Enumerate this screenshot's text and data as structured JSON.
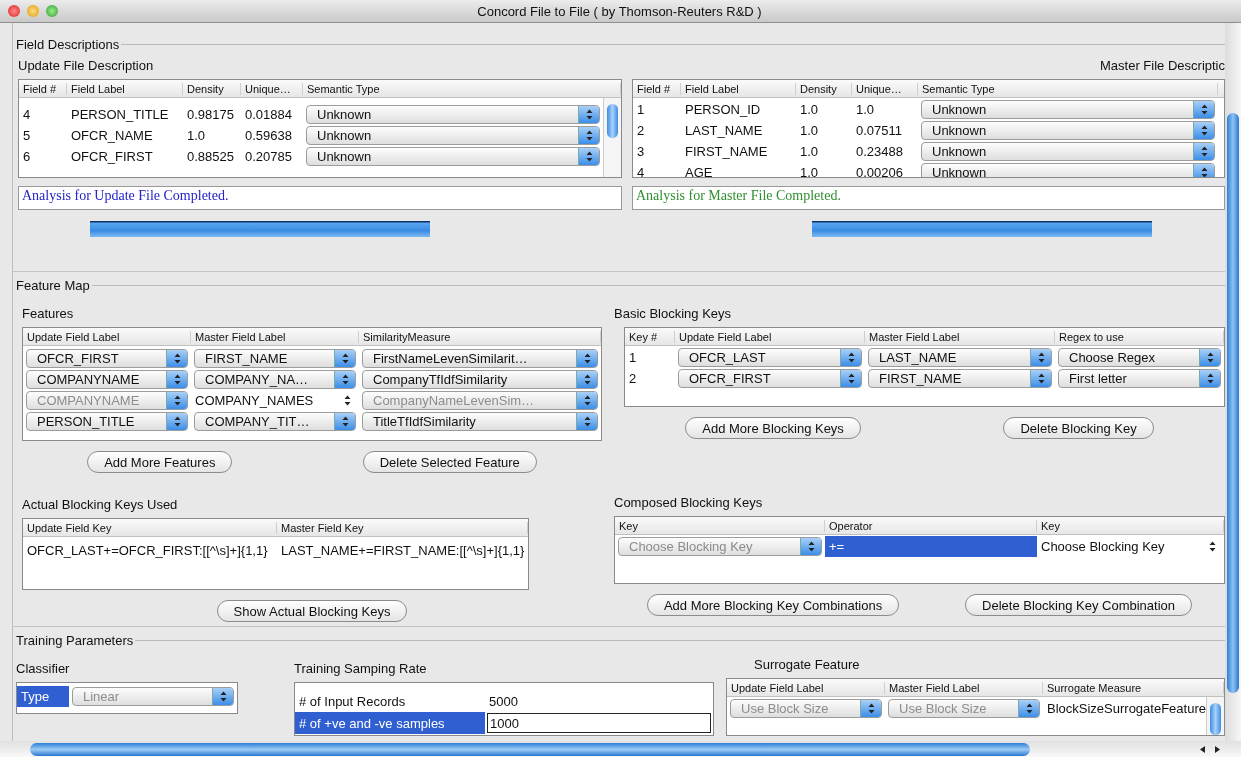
{
  "window": {
    "title": "Concord File to File ( by Thomson-Reuters R&D )"
  },
  "field_descriptions": {
    "title": "Field Descriptions",
    "update": {
      "title": "Update File Description",
      "columns": [
        "Field #",
        "Field Label",
        "Density",
        "Unique…",
        "Semantic Type"
      ],
      "rows": [
        [
          "4",
          "PERSON_TITLE",
          "0.98175",
          "0.01884",
          {
            "kind": "combo",
            "value": "Unknown",
            "disabled": false
          }
        ],
        [
          "5",
          "OFCR_NAME",
          "1.0",
          "0.59638",
          {
            "kind": "combo",
            "value": "Unknown",
            "disabled": false
          }
        ],
        [
          "6",
          "OFCR_FIRST",
          "0.88525",
          "0.20785",
          {
            "kind": "combo",
            "value": "Unknown",
            "disabled": false
          }
        ]
      ],
      "status": "Analysis for Update File Completed.",
      "color": "#2323c8",
      "progress": {
        "level": 1
      }
    },
    "master": {
      "title": "Master File Descriptic",
      "columns": [
        "Field #",
        "Field Label",
        "Density",
        "Unique…",
        "Semantic Type"
      ],
      "rows": [
        [
          "1",
          "PERSON_ID",
          "1.0",
          "1.0",
          {
            "kind": "combo",
            "value": "Unknown",
            "disabled": false
          }
        ],
        [
          "2",
          "LAST_NAME",
          "1.0",
          "0.07511",
          {
            "kind": "combo",
            "value": "Unknown",
            "disabled": false
          }
        ],
        [
          "3",
          "FIRST_NAME",
          "1.0",
          "0.23488",
          {
            "kind": "combo",
            "value": "Unknown",
            "disabled": false
          }
        ],
        [
          "4",
          "AGE",
          "1.0",
          "0.00206",
          {
            "kind": "combo",
            "value": "Unknown",
            "disabled": false
          }
        ]
      ],
      "status": "Analysis for Master File Completed.",
      "color": "#2f8f2f",
      "progress": {
        "level": 1
      }
    }
  },
  "feature_map": {
    "title": "Feature Map",
    "features": {
      "title": "Features",
      "columns": [
        "Update Field Label",
        "Master Field Label",
        "SimilarityMeasure"
      ],
      "rows": [
        [
          {
            "kind": "combo",
            "value": "OFCR_FIRST",
            "disabled": false
          },
          {
            "kind": "combo",
            "value": "FIRST_NAME",
            "disabled": false
          },
          {
            "kind": "combo",
            "value": "FirstNameLevenSimilarit…",
            "disabled": false
          }
        ],
        [
          {
            "kind": "combo",
            "value": "COMPANYNAME",
            "disabled": false
          },
          {
            "kind": "combo",
            "value": "COMPANY_NA…",
            "disabled": false
          },
          {
            "kind": "combo",
            "value": "CompanyTfIdfSimilarity",
            "disabled": false
          }
        ],
        [
          {
            "kind": "combo",
            "value": "COMPANYNAME",
            "disabled": true
          },
          {
            "kind": "spinner",
            "value": "COMPANY_NAMES"
          },
          {
            "kind": "combo",
            "value": "CompanyNameLevenSim…",
            "disabled": true
          }
        ],
        [
          {
            "kind": "combo",
            "value": "PERSON_TITLE",
            "disabled": false
          },
          {
            "kind": "combo",
            "value": "COMPANY_TIT…",
            "disabled": false
          },
          {
            "kind": "combo",
            "value": "TitleTfIdfSimilarity",
            "disabled": false
          }
        ]
      ],
      "buttons": [
        "Add More Features",
        "Delete Selected Feature"
      ]
    },
    "actual_keys": {
      "title": "Actual Blocking Keys Used",
      "columns": [
        "Update Field Key",
        "Master Field Key"
      ],
      "rows": [
        [
          "OFCR_LAST+=OFCR_FIRST:[[^\\s]+]{1,1}",
          "LAST_NAME+=FIRST_NAME:[[^\\s]+]{1,1}"
        ]
      ],
      "buttons": [
        "Show Actual Blocking Keys"
      ]
    },
    "basic_keys": {
      "title": "Basic Blocking Keys",
      "columns": [
        "Key #",
        "Update Field Label",
        "Master Field Label",
        "Regex to use"
      ],
      "rows": [
        [
          "1",
          {
            "kind": "combo",
            "value": "OFCR_LAST",
            "disabled": false
          },
          {
            "kind": "combo",
            "value": "LAST_NAME",
            "disabled": false
          },
          {
            "kind": "combo",
            "value": "Choose Regex",
            "disabled": false
          }
        ],
        [
          "2",
          {
            "kind": "combo",
            "value": "OFCR_FIRST",
            "disabled": false
          },
          {
            "kind": "combo",
            "value": "FIRST_NAME",
            "disabled": false
          },
          {
            "kind": "combo",
            "value": "First letter",
            "disabled": false
          }
        ]
      ],
      "buttons": [
        "Add More Blocking Keys",
        "Delete Blocking Key"
      ]
    },
    "composed_keys": {
      "title": "Composed Blocking Keys",
      "columns": [
        "Key",
        "Operator",
        "Key"
      ],
      "rows": [
        [
          {
            "kind": "combo",
            "value": "Choose Blocking Key",
            "disabled": true
          },
          {
            "kind": "text",
            "value": "+=",
            "selected": true
          },
          {
            "kind": "spinner",
            "value": "Choose Blocking Key"
          }
        ]
      ],
      "buttons": [
        "Add More Blocking Key Combinations",
        "Delete Blocking Key Combination"
      ]
    }
  },
  "training": {
    "title": "Training Parameters",
    "classifier": {
      "title": "Classifier",
      "rows": [
        [
          {
            "kind": "text",
            "value": "Type",
            "selected": true
          },
          {
            "kind": "combo",
            "value": "Linear",
            "disabled": true
          }
        ]
      ]
    },
    "sampling": {
      "title": "Training Samping Rate",
      "rows": [
        [
          {
            "kind": "text",
            "value": "# of Input Records",
            "selected": false
          },
          {
            "kind": "text",
            "value": "5000",
            "selected": false
          }
        ],
        [
          {
            "kind": "text",
            "value": "# of +ve and -ve samples",
            "selected": true
          },
          {
            "kind": "input",
            "value": "1000"
          }
        ]
      ]
    },
    "surrogate": {
      "title": "Surrogate Feature",
      "columns": [
        "Update Field Label",
        "Master Field Label",
        "Surrogate Measure"
      ],
      "rows": [
        [
          {
            "kind": "combo",
            "value": "Use Block Size",
            "disabled": true
          },
          {
            "kind": "combo",
            "value": "Use Block Size",
            "disabled": true
          },
          "BlockSizeSurrogateFeature"
        ]
      ]
    }
  }
}
